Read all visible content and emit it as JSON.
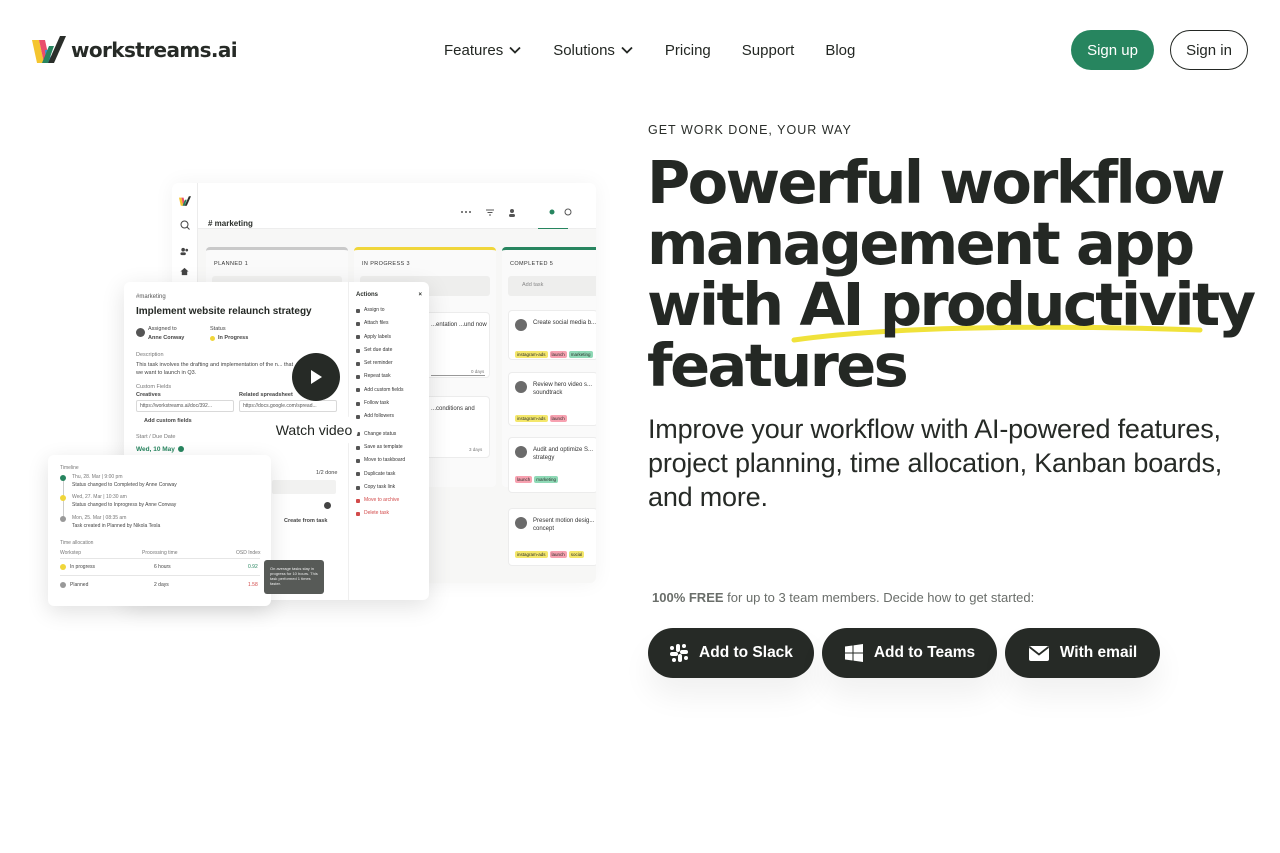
{
  "brand": {
    "name": "workstreams.ai"
  },
  "nav": {
    "items": [
      {
        "label": "Features",
        "has_dropdown": true
      },
      {
        "label": "Solutions",
        "has_dropdown": true
      },
      {
        "label": "Pricing",
        "has_dropdown": false
      },
      {
        "label": "Support",
        "has_dropdown": false
      },
      {
        "label": "Blog",
        "has_dropdown": false
      }
    ],
    "sign_up": "Sign up",
    "sign_in": "Sign in"
  },
  "hero": {
    "eyebrow": "GET WORK DONE, YOUR WAY",
    "headline_lines": [
      "Powerful workflow",
      "management app",
      "with AI productivity",
      "features"
    ],
    "subhead": "Improve your workflow with AI-powered features, project planning, time allocation, Kanban boards, and more.",
    "free_bold": "100% FREE",
    "free_rest": " for up to 3 team members.  Decide how to get started:",
    "cta": {
      "slack": "Add to Slack",
      "teams": "Add to Teams",
      "email": "With email"
    },
    "watch_video": "Watch video"
  },
  "colors": {
    "accent_green": "#27855f",
    "dark": "#262a26",
    "highlight_yellow": "#f0e23a"
  },
  "mockup": {
    "board_title": "# marketing",
    "columns": [
      {
        "title": "PLANNED  1"
      },
      {
        "title": "IN PROGRESS  3"
      },
      {
        "title": "COMPLETED  5"
      }
    ],
    "add_task": "Add task",
    "in_progress_cards": [
      "...entation ...und now",
      "...conditions and"
    ],
    "completed_cards": [
      "Create social media b...",
      "Review hero video s... soundtrack",
      "Audit and optimize S... strategy",
      "Present motion desig... concept"
    ],
    "task": {
      "crumb": "#marketing",
      "title": "Implement website relaunch strategy",
      "assigned_label": "Assigned to",
      "assigned_value": "Anne Conway",
      "status_label": "Status",
      "status_value": "In Progress",
      "description_label": "Description",
      "description": "This task involves the drafting and implementation of the n... that we want to launch in Q3.",
      "custom_fields_label": "Custom Fields",
      "creatives_label": "Creatives",
      "creatives_value": "https://workstreams.ai/doc/392...",
      "spreadsheet_label": "Related spreadsheet",
      "spreadsheet_value": "https://docs.google.com/spread...",
      "add_custom_fields": "Add custom fields",
      "dates_label": "Start / Due Date",
      "due": "Wed, 10 May",
      "done": "1/2 done",
      "create_from_task": "Create from task"
    },
    "actions_title": "Actions",
    "actions": [
      "Assign to",
      "Attach files",
      "Apply labels",
      "Set due date",
      "Set reminder",
      "Repeat task",
      "Add custom fields",
      "Follow task",
      "Add followers",
      "Change status",
      "Save as template",
      "Move to taskboard",
      "Duplicate task",
      "Copy task link",
      "Move to archive",
      "Delete task"
    ],
    "timeline": {
      "label": "Timeline",
      "entries": [
        {
          "date": "Thu, 28. Mar | 9:00 pm",
          "text": "Status changed to Completed by Anne Conway"
        },
        {
          "date": "Wed, 27. Mar | 10:30 am",
          "text": "Status changed to Inprogress by Anne Conway"
        },
        {
          "date": "Mon, 25. Mar | 08:35 am",
          "text": "Task created in Planned by Nikola Tesla"
        }
      ],
      "time_allocation": "Time allocation",
      "headers": [
        "Workstep",
        "Processing time",
        "OSD Index"
      ],
      "rows": [
        {
          "step": "In progress",
          "time": "6  hours",
          "index": "0.92"
        },
        {
          "step": "Planned",
          "time": "2  days",
          "index": "1.58"
        }
      ]
    },
    "tooltip": "On average tasks stay in progress for 10 hours. This task performed 1 times faster."
  }
}
